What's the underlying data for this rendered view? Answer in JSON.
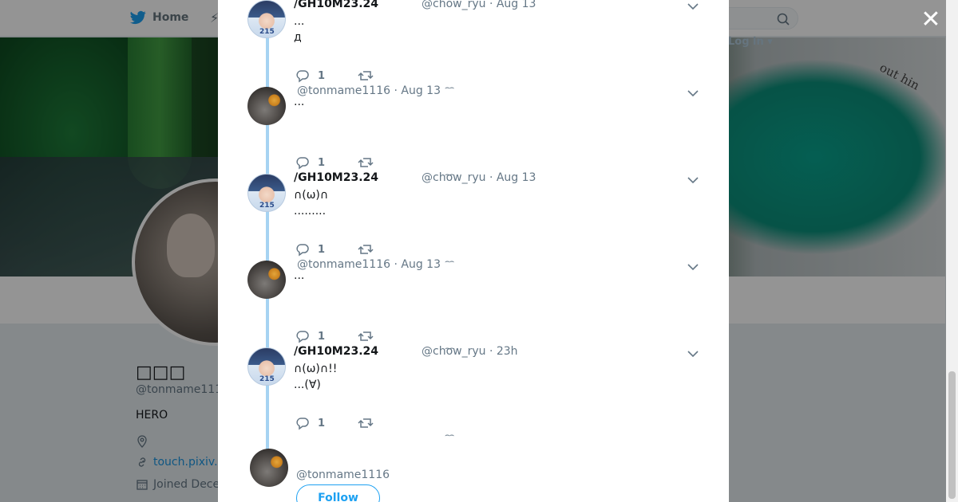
{
  "topbar": {
    "home_label": "Home",
    "login_label": "Log in"
  },
  "banner": {
    "overlay_text": "out hin"
  },
  "profile": {
    "name": "□□□",
    "handle": "@tonmame111",
    "bio": "HERO",
    "link": "touch.pixiv.",
    "joined": "Joined Dece"
  },
  "modal": {
    "tweets": [
      {
        "author": "/GH10M23.24",
        "handle": "@chow_ryu · Aug 13",
        "lines": [
          "...",
          "д"
        ],
        "reply_count": "1",
        "avatar": "anime-avatar"
      },
      {
        "author": "",
        "handle": "@tonmame1116 · Aug 13",
        "lines": [
          "..."
        ],
        "reply_count": "1",
        "avatar": "dog-avatar"
      },
      {
        "author": "/GH10M23.24",
        "handle": "@chow_ryu · Aug 13",
        "lines": [
          "∩(ω)∩",
          "........."
        ],
        "reply_count": "1",
        "avatar": "anime-avatar"
      },
      {
        "author": "",
        "handle": "@tonmame1116 · Aug 13",
        "lines": [
          "..."
        ],
        "reply_count": "1",
        "avatar": "dog-avatar"
      },
      {
        "author": "/GH10M23.24",
        "handle": "@chow_ryu · 23h",
        "lines": [
          "∩(ω)∩!!",
          "...(∀)"
        ],
        "reply_count": "1",
        "avatar": "anime-avatar"
      }
    ],
    "footer": {
      "handle": "@tonmame1116",
      "follow_label": "Follow"
    },
    "close_icon": "close-icon",
    "more_dots": "⌢⌢"
  },
  "colors": {
    "accent": "#1da1f2",
    "thread_line": "#a6d3f2"
  }
}
